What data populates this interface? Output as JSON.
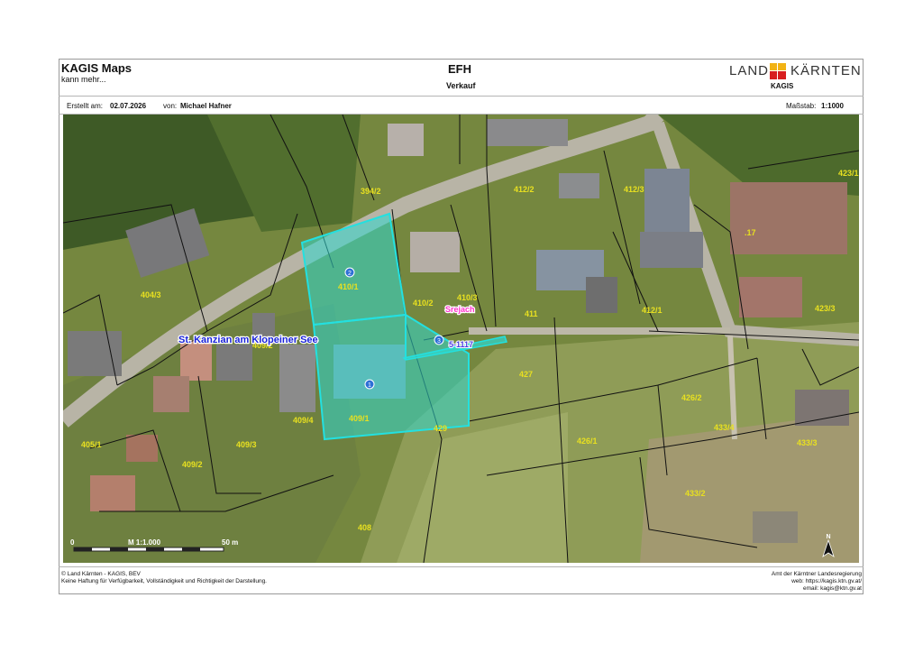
{
  "header": {
    "app_title": "KAGIS Maps",
    "app_subtitle": "kann mehr...",
    "doc_title": "EFH",
    "doc_subtitle": "Verkauf",
    "logo_left": "LAND",
    "logo_right": "KÄRNTEN",
    "logo_sub": "KAGIS"
  },
  "info": {
    "created_label": "Erstellt am:",
    "created_value": "02.07.2026",
    "author_label": "von:",
    "author_value": "Michael Hafner",
    "scale_label": "Maßstab:",
    "scale_value": "1:1000"
  },
  "map": {
    "place_label": "St. Kanzian am Klopeiner See",
    "river_label": "Srejach",
    "river_code": "5-1117",
    "parcels": [
      "394/2",
      "412/2",
      "412/3",
      "423/1",
      ".17",
      "404/3",
      "410/1",
      "410/2",
      "410/3",
      "411",
      "412/1",
      "423/3",
      "409/2",
      "427",
      "426/2",
      "409/1",
      "409/4",
      "409/3",
      "405/1",
      "409/2",
      "429",
      "426/1",
      "433/4",
      "433/3",
      "433/2",
      "408"
    ],
    "markers": [
      "2",
      "1",
      "3"
    ],
    "scalebar": {
      "start": "0",
      "mid": "M 1:1.000",
      "end": "50 m"
    },
    "north_label": "N",
    "colors": {
      "selection": "#23e0e0",
      "selection_fill": "#2fd8d0",
      "parcel_label": "#e8e020",
      "marker": "#2d6fd6"
    }
  },
  "footer": {
    "left_line1": "© Land Kärnten - KAGIS, BEV",
    "left_line2": "Keine Haftung für Verfügbarkeit, Vollständigkeit und Richtigkeit der Darstellung.",
    "right_line1": "Amt der Kärntner Landesregierung",
    "right_line2": "web: https://kagis.ktn.gv.at/",
    "right_line3": "email: kagis@ktn.gv.at"
  }
}
